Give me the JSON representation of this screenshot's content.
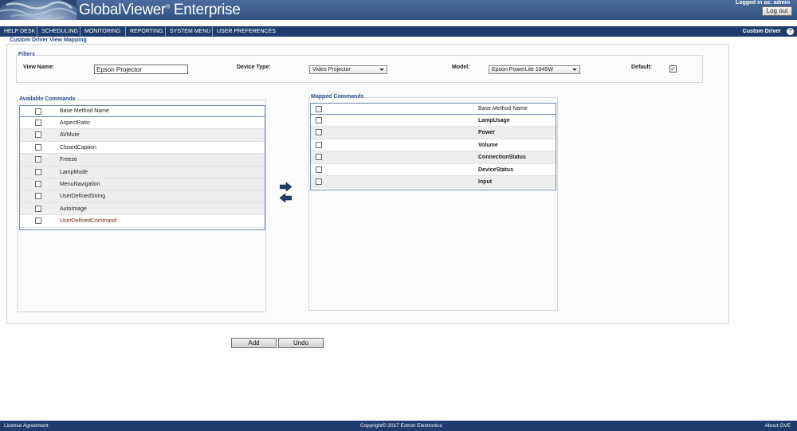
{
  "header": {
    "app_title": "GlobalViewer",
    "app_title_suffix": "Enterprise",
    "trademark": "®",
    "logged_in": "Logged in as: admin",
    "logout_label": "Log out"
  },
  "nav": {
    "items": [
      {
        "label": "HELP DESK"
      },
      {
        "label": "SCHEDULING"
      },
      {
        "label": "MONITORING"
      },
      {
        "label": "REPORTING"
      },
      {
        "label": "SYSTEM MENU"
      },
      {
        "label": "USER PREFERENCES"
      }
    ],
    "right_label": "Custom Driver",
    "help_icon": "?"
  },
  "page": {
    "title": "Custom Driver View Mapping"
  },
  "filters": {
    "legend": "Filters",
    "view_name_label": "View Name:",
    "view_name_value": "Epson Projector",
    "device_type_label": "Device Type:",
    "device_type_value": "Video Projector",
    "model_label": "Model:",
    "model_value": "Epson PowerLite 1945W",
    "default_label": "Default:",
    "default_checked": true,
    "default_check_glyph": "✓"
  },
  "available": {
    "legend": "Available Commands",
    "column_header": "Base Method Name",
    "items": [
      {
        "name": "AspectRatio"
      },
      {
        "name": "AVMute"
      },
      {
        "name": "ClosedCaption"
      },
      {
        "name": "Freeze"
      },
      {
        "name": "LampMode"
      },
      {
        "name": "MenuNavigation"
      },
      {
        "name": "UserDefinedString"
      },
      {
        "name": "AutoImage"
      },
      {
        "name": "UserDefinedCommand"
      }
    ]
  },
  "mapped": {
    "legend": "Mapped Commands",
    "column_header": "Base Method Name",
    "items": [
      {
        "name": "LampUsage"
      },
      {
        "name": "Power"
      },
      {
        "name": "Volume"
      },
      {
        "name": "ConnectionStatus"
      },
      {
        "name": "DeviceStatus"
      },
      {
        "name": "Input"
      }
    ]
  },
  "move_icons": {
    "right": "arrow-right-icon",
    "left": "arrow-left-icon"
  },
  "actions": {
    "add_label": "Add",
    "undo_label": "Undo"
  },
  "footer": {
    "license": "License Agreement",
    "copyright": "Copyright© 2017 Extron Electronics",
    "about": "About GVE"
  },
  "colors": {
    "header_blue": "#3c5e8e",
    "nav_blue": "#1e3d6e",
    "legend_blue": "#2a4b8a",
    "arrow_blue": "#1f3d66"
  }
}
